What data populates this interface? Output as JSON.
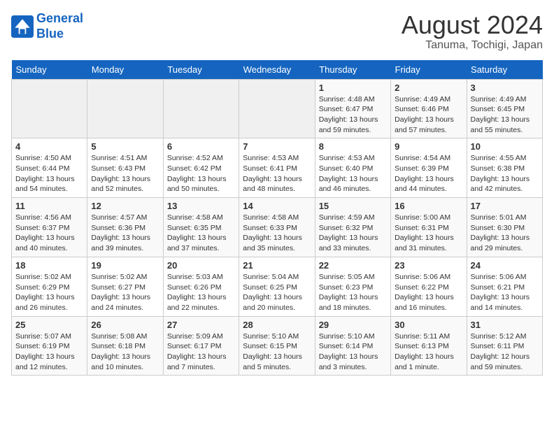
{
  "logo": {
    "line1": "General",
    "line2": "Blue"
  },
  "title": {
    "month_year": "August 2024",
    "location": "Tanuma, Tochigi, Japan"
  },
  "days_of_week": [
    "Sunday",
    "Monday",
    "Tuesday",
    "Wednesday",
    "Thursday",
    "Friday",
    "Saturday"
  ],
  "weeks": [
    [
      {
        "day": "",
        "content": ""
      },
      {
        "day": "",
        "content": ""
      },
      {
        "day": "",
        "content": ""
      },
      {
        "day": "",
        "content": ""
      },
      {
        "day": "1",
        "content": "Sunrise: 4:48 AM\nSunset: 6:47 PM\nDaylight: 13 hours\nand 59 minutes."
      },
      {
        "day": "2",
        "content": "Sunrise: 4:49 AM\nSunset: 6:46 PM\nDaylight: 13 hours\nand 57 minutes."
      },
      {
        "day": "3",
        "content": "Sunrise: 4:49 AM\nSunset: 6:45 PM\nDaylight: 13 hours\nand 55 minutes."
      }
    ],
    [
      {
        "day": "4",
        "content": "Sunrise: 4:50 AM\nSunset: 6:44 PM\nDaylight: 13 hours\nand 54 minutes."
      },
      {
        "day": "5",
        "content": "Sunrise: 4:51 AM\nSunset: 6:43 PM\nDaylight: 13 hours\nand 52 minutes."
      },
      {
        "day": "6",
        "content": "Sunrise: 4:52 AM\nSunset: 6:42 PM\nDaylight: 13 hours\nand 50 minutes."
      },
      {
        "day": "7",
        "content": "Sunrise: 4:53 AM\nSunset: 6:41 PM\nDaylight: 13 hours\nand 48 minutes."
      },
      {
        "day": "8",
        "content": "Sunrise: 4:53 AM\nSunset: 6:40 PM\nDaylight: 13 hours\nand 46 minutes."
      },
      {
        "day": "9",
        "content": "Sunrise: 4:54 AM\nSunset: 6:39 PM\nDaylight: 13 hours\nand 44 minutes."
      },
      {
        "day": "10",
        "content": "Sunrise: 4:55 AM\nSunset: 6:38 PM\nDaylight: 13 hours\nand 42 minutes."
      }
    ],
    [
      {
        "day": "11",
        "content": "Sunrise: 4:56 AM\nSunset: 6:37 PM\nDaylight: 13 hours\nand 40 minutes."
      },
      {
        "day": "12",
        "content": "Sunrise: 4:57 AM\nSunset: 6:36 PM\nDaylight: 13 hours\nand 39 minutes."
      },
      {
        "day": "13",
        "content": "Sunrise: 4:58 AM\nSunset: 6:35 PM\nDaylight: 13 hours\nand 37 minutes."
      },
      {
        "day": "14",
        "content": "Sunrise: 4:58 AM\nSunset: 6:33 PM\nDaylight: 13 hours\nand 35 minutes."
      },
      {
        "day": "15",
        "content": "Sunrise: 4:59 AM\nSunset: 6:32 PM\nDaylight: 13 hours\nand 33 minutes."
      },
      {
        "day": "16",
        "content": "Sunrise: 5:00 AM\nSunset: 6:31 PM\nDaylight: 13 hours\nand 31 minutes."
      },
      {
        "day": "17",
        "content": "Sunrise: 5:01 AM\nSunset: 6:30 PM\nDaylight: 13 hours\nand 29 minutes."
      }
    ],
    [
      {
        "day": "18",
        "content": "Sunrise: 5:02 AM\nSunset: 6:29 PM\nDaylight: 13 hours\nand 26 minutes."
      },
      {
        "day": "19",
        "content": "Sunrise: 5:02 AM\nSunset: 6:27 PM\nDaylight: 13 hours\nand 24 minutes."
      },
      {
        "day": "20",
        "content": "Sunrise: 5:03 AM\nSunset: 6:26 PM\nDaylight: 13 hours\nand 22 minutes."
      },
      {
        "day": "21",
        "content": "Sunrise: 5:04 AM\nSunset: 6:25 PM\nDaylight: 13 hours\nand 20 minutes."
      },
      {
        "day": "22",
        "content": "Sunrise: 5:05 AM\nSunset: 6:23 PM\nDaylight: 13 hours\nand 18 minutes."
      },
      {
        "day": "23",
        "content": "Sunrise: 5:06 AM\nSunset: 6:22 PM\nDaylight: 13 hours\nand 16 minutes."
      },
      {
        "day": "24",
        "content": "Sunrise: 5:06 AM\nSunset: 6:21 PM\nDaylight: 13 hours\nand 14 minutes."
      }
    ],
    [
      {
        "day": "25",
        "content": "Sunrise: 5:07 AM\nSunset: 6:19 PM\nDaylight: 13 hours\nand 12 minutes."
      },
      {
        "day": "26",
        "content": "Sunrise: 5:08 AM\nSunset: 6:18 PM\nDaylight: 13 hours\nand 10 minutes."
      },
      {
        "day": "27",
        "content": "Sunrise: 5:09 AM\nSunset: 6:17 PM\nDaylight: 13 hours\nand 7 minutes."
      },
      {
        "day": "28",
        "content": "Sunrise: 5:10 AM\nSunset: 6:15 PM\nDaylight: 13 hours\nand 5 minutes."
      },
      {
        "day": "29",
        "content": "Sunrise: 5:10 AM\nSunset: 6:14 PM\nDaylight: 13 hours\nand 3 minutes."
      },
      {
        "day": "30",
        "content": "Sunrise: 5:11 AM\nSunset: 6:13 PM\nDaylight: 13 hours\nand 1 minute."
      },
      {
        "day": "31",
        "content": "Sunrise: 5:12 AM\nSunset: 6:11 PM\nDaylight: 12 hours\nand 59 minutes."
      }
    ]
  ]
}
